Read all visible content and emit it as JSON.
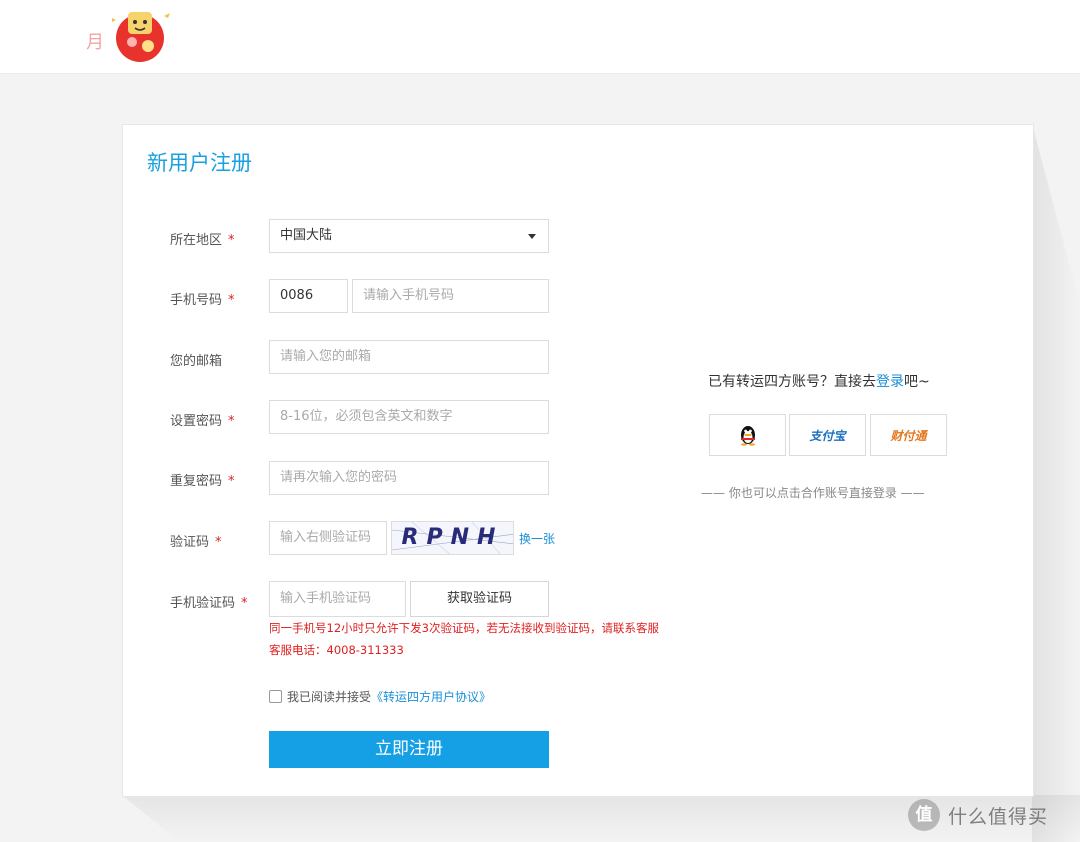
{
  "header": {
    "logo_char": "月"
  },
  "form": {
    "title": "新用户注册",
    "required_mark": "*",
    "region": {
      "label": "所在地区",
      "value": "中国大陆"
    },
    "phone": {
      "label": "手机号码",
      "country_code": "0086",
      "placeholder": "请输入手机号码"
    },
    "email": {
      "label": "您的邮箱",
      "placeholder": "请输入您的邮箱"
    },
    "password": {
      "label": "设置密码",
      "placeholder": "8-16位，必须包含英文和数字"
    },
    "password_repeat": {
      "label": "重复密码",
      "placeholder": "请再次输入您的密码"
    },
    "captcha": {
      "label": "验证码",
      "placeholder": "输入右侧验证码",
      "image_text": "RPNH",
      "refresh_label": "换一张"
    },
    "sms": {
      "label": "手机验证码",
      "placeholder": "输入手机验证码",
      "button_label": "获取验证码"
    },
    "warning_line1": "同一手机号12小时只允许下发3次验证码，若无法接收到验证码，请联系客服",
    "warning_line2": "客服电话：4008-311333",
    "agreement": {
      "prefix": "我已阅读并接受",
      "link": "《转运四方用户协议》",
      "checked": false
    },
    "submit_label": "立即注册"
  },
  "side": {
    "login_prefix": "已有转运四方账号？直接去",
    "login_link": "登录",
    "login_suffix": "吧~",
    "partners": [
      {
        "name": "QQ",
        "icon": "qq-penguin-icon"
      },
      {
        "name": "支付宝",
        "icon": "alipay-logo"
      },
      {
        "name": "财付通",
        "icon": "tenpay-logo"
      }
    ],
    "partner_hint": "—— 你也可以点击合作账号直接登录 ——"
  },
  "watermark": {
    "glyph": "值",
    "text": "什么值得买"
  }
}
